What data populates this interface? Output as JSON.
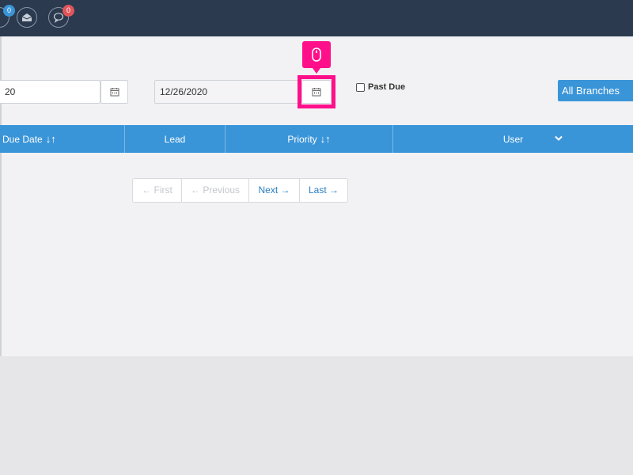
{
  "topbar": {
    "icons": [
      {
        "name": "user-icon",
        "badge": "0",
        "badge_color": "#3a95d8"
      },
      {
        "name": "inbox-icon"
      },
      {
        "name": "chat-icon",
        "badge": "0",
        "badge_color": "#e0555a"
      }
    ]
  },
  "filters": {
    "start_date_value": "20",
    "end_date_value": "12/26/2020",
    "past_due_label": "Past Due",
    "past_due_checked": false,
    "branch_select": "All Branches"
  },
  "table": {
    "columns": [
      {
        "label": "Due Date",
        "sortable": true
      },
      {
        "label": "Lead",
        "sortable": false
      },
      {
        "label": "Priority",
        "sortable": true
      },
      {
        "label": "User",
        "sortable": false
      }
    ]
  },
  "pagination": {
    "first": "← First",
    "previous": "← Previous",
    "next": "Next →",
    "last": "Last →"
  },
  "colors": {
    "topbar": "#2b3a4f",
    "accent": "#3a95d8",
    "highlight": "#ff0f8a"
  }
}
